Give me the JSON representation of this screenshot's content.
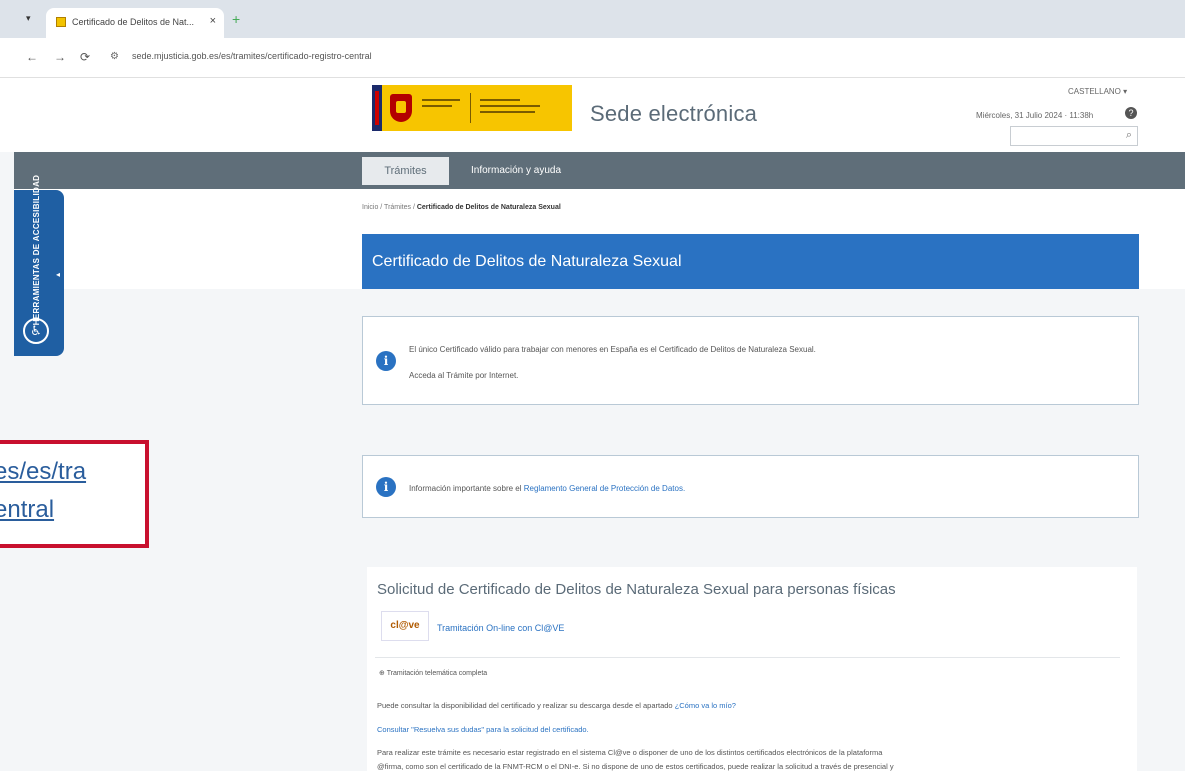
{
  "browser": {
    "tab_title": "Certificado de Delitos de Nat...",
    "tab_close": "×",
    "new_tab": "+",
    "url": "sede.mjusticia.gob.es/es/tramites/certificado-registro-central"
  },
  "header": {
    "site_title": "Sede electrónica",
    "language": "CASTELLANO ▾",
    "date": "Miércoles, 31 Julio 2024 · 11:38h",
    "help": "?"
  },
  "nav": {
    "tabs": [
      {
        "label": "Trámites"
      },
      {
        "label": "Información y ayuda"
      }
    ]
  },
  "accessibility": {
    "label": "HERRAMIENTAS DE ACCESIBILIDAD"
  },
  "breadcrumb": {
    "path": "Inicio / Trámites / ",
    "current": "Certificado de Delitos de Naturaleza Sexual"
  },
  "title": "Certificado de Delitos de Naturaleza Sexual",
  "info1": {
    "line1": "El único Certificado válido para trabajar con menores en España es el Certificado de Delitos de Naturaleza Sexual.",
    "line2": "Acceda al Trámite por Internet."
  },
  "info2": {
    "prefix": "Información importante sobre el ",
    "link": "Reglamento General de Protección de Datos."
  },
  "highlight": {
    "line1": "es/es/tra",
    "line2": "entral"
  },
  "solicitud": {
    "title": "Solicitud de Certificado de Delitos de Naturaleza Sexual para personas físicas",
    "clave_logo": "cl@ve",
    "clave_link": "Tramitación On-line con Cl@VE",
    "option": "Tramitación telemática completa",
    "line1_prefix": "Puede consultar la disponibilidad del certificado y realizar su descarga desde el apartado ",
    "line1_link": "¿Cómo va lo mío?",
    "line2_link": "Consultar \"Resuelva sus dudas\" para la solicitud del certificado.",
    "line3": "Para realizar este trámite es necesario estar registrado en el sistema Cl@ve o disponer de uno de los distintos certificados electrónicos de la plataforma",
    "line4": "@firma, como son el certificado de la FNMT-RCM o el DNI-e. Si no dispone de uno de estos certificados, puede realizar la solicitud a través de presencial y"
  },
  "colors": {
    "accent": "#2a72c2",
    "navbar": "#5f6e79",
    "highlight_border": "#c8102e"
  }
}
